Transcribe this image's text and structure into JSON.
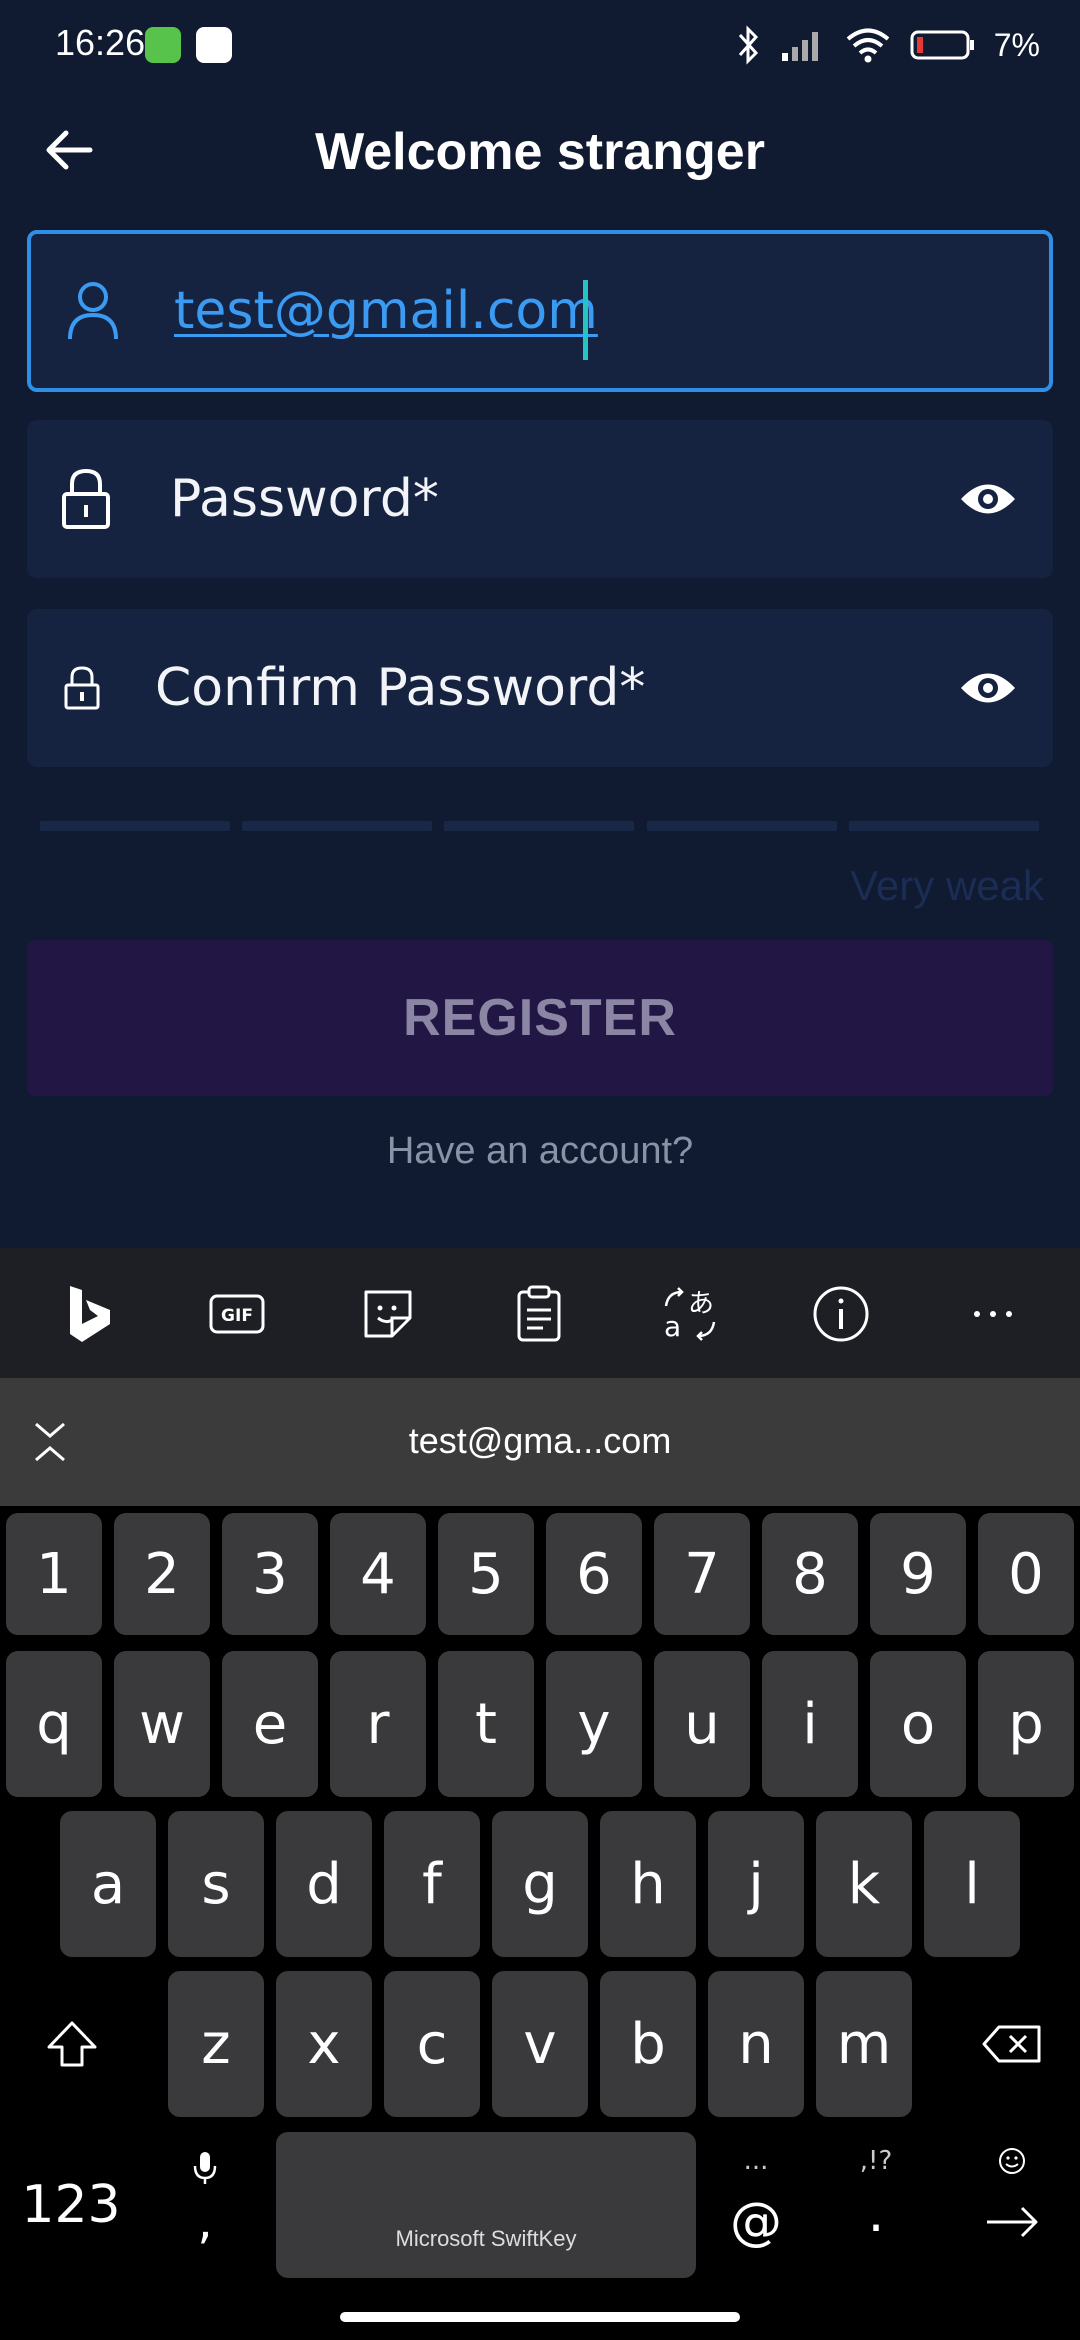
{
  "status_bar": {
    "time": "16:26",
    "battery": "7%"
  },
  "header": {
    "title": "Welcome stranger"
  },
  "form": {
    "email_value": "test@gmail.com",
    "password_placeholder": "Password*",
    "confirm_placeholder": "Confirm Password*",
    "strength_label": "Very weak",
    "register_label": "REGISTER",
    "have_account": "Have an account?"
  },
  "keyboard": {
    "toolbar_icons": [
      "bing-icon",
      "gif-icon",
      "sticker-icon",
      "clipboard-icon",
      "translate-icon",
      "info-icon",
      "more-icon"
    ],
    "suggestion": "test@gma...com",
    "rows": {
      "numbers": [
        "1",
        "2",
        "3",
        "4",
        "5",
        "6",
        "7",
        "8",
        "9",
        "0"
      ],
      "row1": [
        "q",
        "w",
        "e",
        "r",
        "t",
        "y",
        "u",
        "i",
        "o",
        "p"
      ],
      "row2": [
        "a",
        "s",
        "d",
        "f",
        "g",
        "h",
        "j",
        "k",
        "l"
      ],
      "row3": [
        "z",
        "x",
        "c",
        "v",
        "b",
        "n",
        "m"
      ]
    },
    "numbers_key": "123",
    "comma_key": ",",
    "space_label": "Microsoft SwiftKey",
    "at_key": "@",
    "at_sub": "...",
    "period_key": ".",
    "period_sub": ",!?"
  }
}
